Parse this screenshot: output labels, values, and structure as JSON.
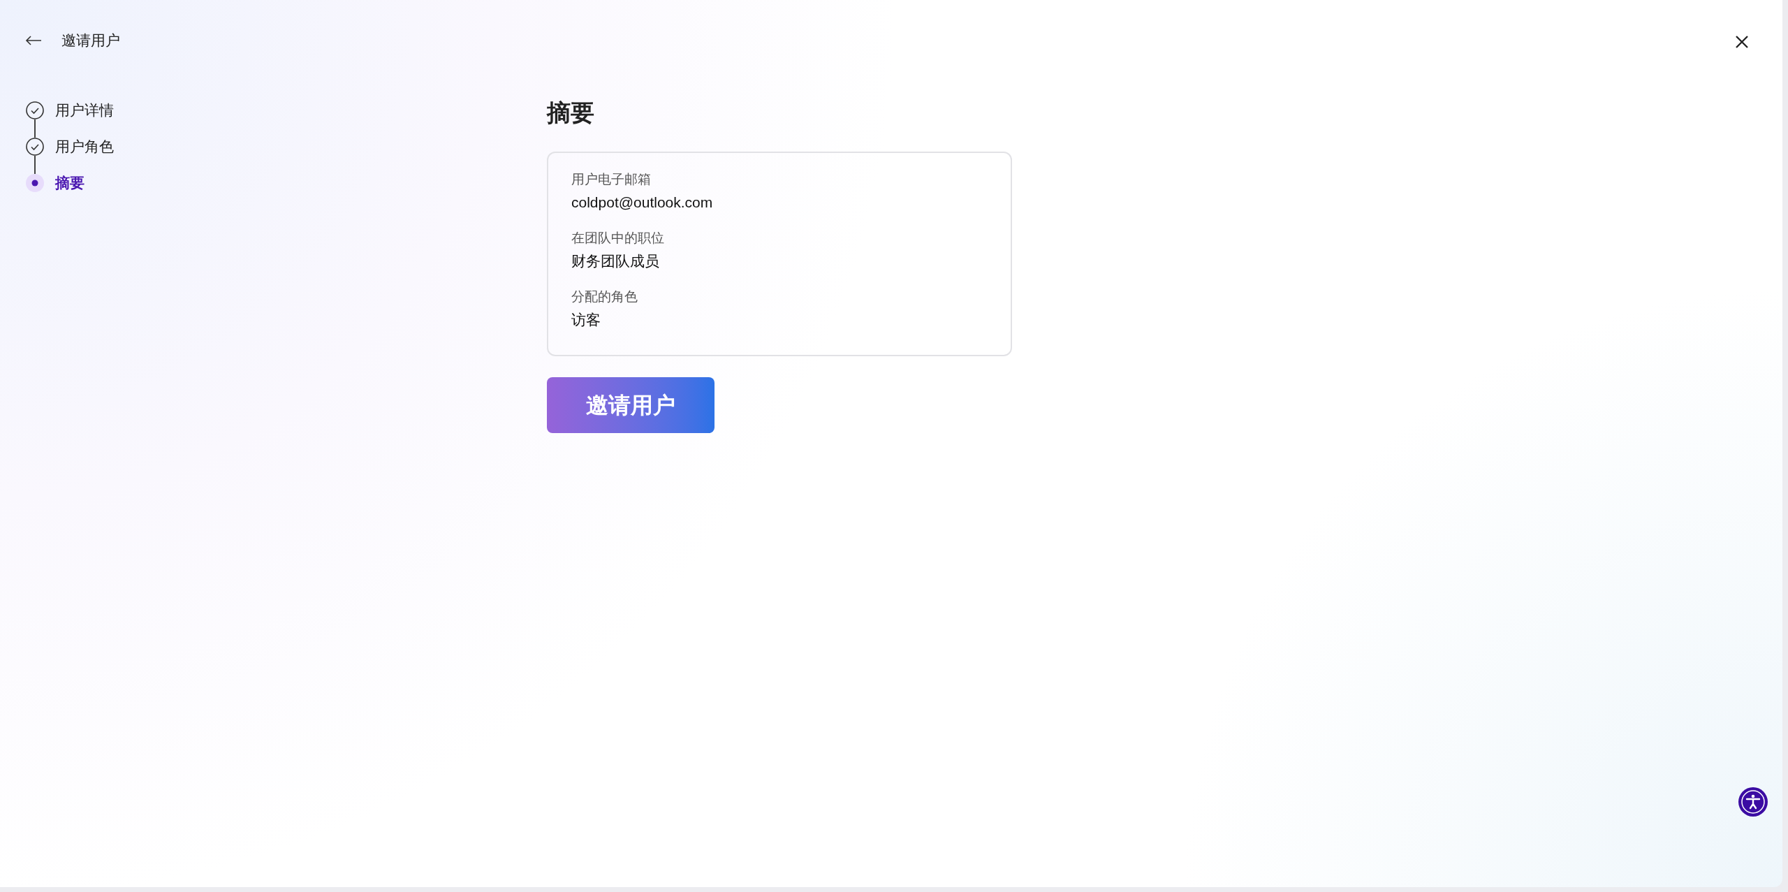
{
  "header": {
    "title": "邀请用户"
  },
  "steps": [
    {
      "label": "用户详情",
      "completed": true,
      "selected": false
    },
    {
      "label": "用户角色",
      "completed": true,
      "selected": false
    },
    {
      "label": "摘要",
      "completed": false,
      "selected": true
    }
  ],
  "summary": {
    "heading": "摘要",
    "fields": [
      {
        "label": "用户电子邮箱",
        "value": "coldpot@outlook.com"
      },
      {
        "label": "在团队中的职位",
        "value": "财务团队成员"
      },
      {
        "label": "分配的角色",
        "value": "访客"
      }
    ]
  },
  "invite_button": "邀请用户"
}
